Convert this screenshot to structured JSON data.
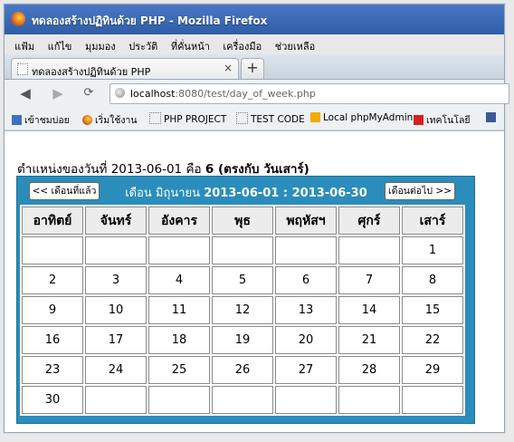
{
  "window": {
    "title": "ทดลองสร้างปฏิทินด้วย PHP - Mozilla Firefox"
  },
  "menu": {
    "items": [
      "แฟ้ม",
      "แก้ไข",
      "มุมมอง",
      "ประวัติ",
      "ที่คั่นหน้า",
      "เครื่องมือ",
      "ช่วยเหลือ"
    ]
  },
  "tab": {
    "label": "ทดลองสร้างปฏิทินด้วย PHP",
    "close": "×",
    "new": "+"
  },
  "url": {
    "host": "localhost",
    "rest": ":8080/test/day_of_week.php"
  },
  "bookmarks": {
    "items": [
      "เข้าชมบ่อย",
      "เริ่มใช้งาน",
      "PHP PROJECT",
      "TEST CODE",
      "Local phpMyAdmin",
      "เทคโนโลยี"
    ]
  },
  "page": {
    "heading_prefix": "ตำแหน่งของวันที่ 2013-06-01 คือ ",
    "heading_bold": "6 (ตรงกับ วันเสาร์)"
  },
  "calendar": {
    "prev_label": "<< เดือนที่แล้ว",
    "next_label": "เดือนต่อไป >>",
    "month_label": "เดือน มิถุนายน ",
    "range_label": "2013-06-01 : 2013-06-30",
    "days": [
      "อาทิตย์",
      "จันทร์",
      "อังคาร",
      "พุธ",
      "พฤหัสฯ",
      "ศุกร์",
      "เสาร์"
    ],
    "weeks": [
      [
        "",
        "",
        "",
        "",
        "",
        "",
        "1"
      ],
      [
        "2",
        "3",
        "4",
        "5",
        "6",
        "7",
        "8"
      ],
      [
        "9",
        "10",
        "11",
        "12",
        "13",
        "14",
        "15"
      ],
      [
        "16",
        "17",
        "18",
        "19",
        "20",
        "21",
        "22"
      ],
      [
        "23",
        "24",
        "25",
        "26",
        "27",
        "28",
        "29"
      ],
      [
        "30",
        "",
        "",
        "",
        "",
        "",
        ""
      ]
    ]
  },
  "colors": {
    "calendar_bg": "#2a8dbb",
    "titlebar": "#2f5ea8"
  }
}
